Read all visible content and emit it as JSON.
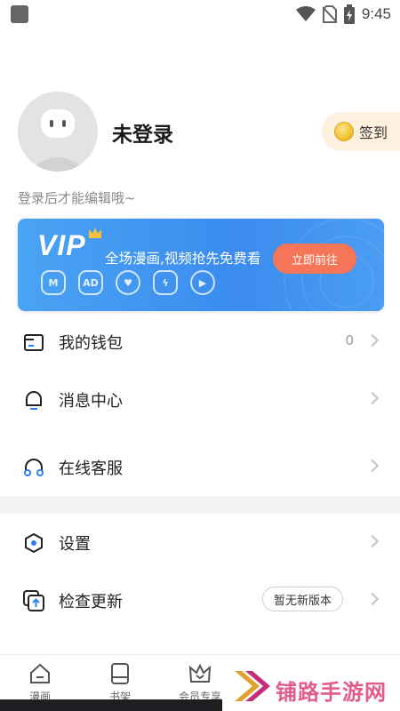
{
  "status_bar": {
    "time": "9:45"
  },
  "profile": {
    "name": "未登录",
    "checkin_label": "签到",
    "hint": "登录后才能编辑哦~"
  },
  "vip": {
    "logo": "VIP",
    "description": "全场漫画,视频抢先免费看",
    "button": "立即前往",
    "perk_icons": [
      "vip-m-icon",
      "ad-free-icon",
      "heart-icon",
      "lightning-badge-icon",
      "play-icon"
    ]
  },
  "menu": {
    "wallet": {
      "label": "我的钱包",
      "count": "0"
    },
    "messages": {
      "label": "消息中心"
    },
    "support": {
      "label": "在线客服"
    },
    "settings": {
      "label": "设置"
    },
    "update": {
      "label": "检查更新",
      "badge": "暂无新版本"
    }
  },
  "tabs": [
    {
      "label": "漫画",
      "icon": "home-icon"
    },
    {
      "label": "书架",
      "icon": "bookshelf-icon"
    },
    {
      "label": "会员专享",
      "icon": "vip-crown-icon"
    }
  ],
  "watermark": {
    "text": "铺路手游网"
  },
  "colors": {
    "vip_blue": "#3b8cee",
    "vip_button": "#f47557",
    "checkin_bg": "#fdf0df",
    "accent_blue": "#2f7ff0",
    "watermark_pink": "#e35b8c"
  }
}
